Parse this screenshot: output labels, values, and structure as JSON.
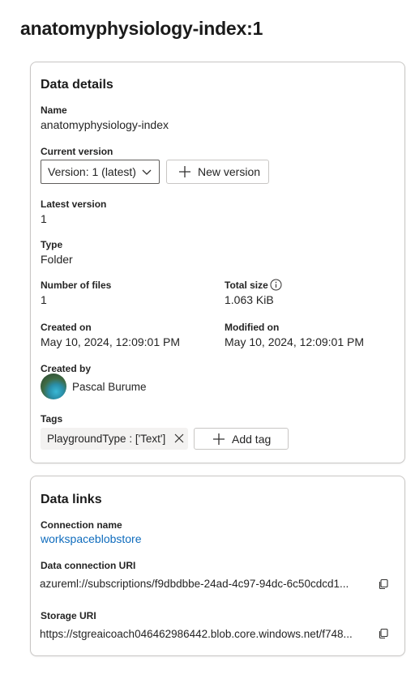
{
  "page": {
    "title": "anatomyphysiology-index:1"
  },
  "details": {
    "title": "Data details",
    "name_label": "Name",
    "name_value": "anatomyphysiology-index",
    "current_version_label": "Current version",
    "current_version_value": "Version: 1 (latest)",
    "new_version_label": "New version",
    "latest_version_label": "Latest version",
    "latest_version_value": "1",
    "type_label": "Type",
    "type_value": "Folder",
    "num_files_label": "Number of files",
    "num_files_value": "1",
    "total_size_label": "Total size",
    "total_size_value": "1.063 KiB",
    "created_on_label": "Created on",
    "created_on_value": "May 10, 2024, 12:09:01 PM",
    "modified_on_label": "Modified on",
    "modified_on_value": "May 10, 2024, 12:09:01 PM",
    "created_by_label": "Created by",
    "created_by_value": "Pascal Burume",
    "tags_label": "Tags",
    "tag_value": "PlaygroundType : ['Text']",
    "add_tag_label": "Add tag"
  },
  "links": {
    "title": "Data links",
    "connection_name_label": "Connection name",
    "connection_name_value": "workspaceblobstore",
    "data_connection_uri_label": "Data connection URI",
    "data_connection_uri_value": "azureml://subscriptions/f9dbdbbe-24ad-4c97-94dc-6c50cdcd1...",
    "storage_uri_label": "Storage URI",
    "storage_uri_value": "https://stgreaicoach046462986442.blob.core.windows.net/f748..."
  },
  "colors": {
    "link": "#0f6cbd",
    "border": "#c8c6c4",
    "chip_bg": "#f3f2f1"
  },
  "icons": [
    "chevron-down-icon",
    "plus-icon",
    "info-icon",
    "close-icon",
    "copy-icon"
  ]
}
